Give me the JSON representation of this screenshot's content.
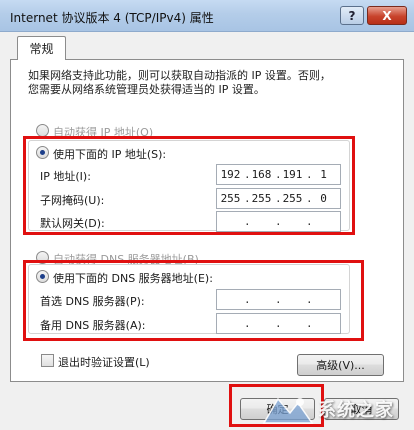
{
  "window": {
    "title": "Internet 协议版本 4 (TCP/IPv4) 属性",
    "help_label": "?",
    "close_label": "X"
  },
  "tab": {
    "label": "常规"
  },
  "description": {
    "line1": "如果网络支持此功能，则可以获取自动指派的 IP 设置。否则，",
    "line2": "您需要从网络系统管理员处获得适当的 IP 设置。"
  },
  "ip_section": {
    "auto_label": "自动获得 IP 地址(O)",
    "manual_label": "使用下面的 IP 地址(S):",
    "selected": "manual",
    "fields": [
      {
        "label": "IP 地址(I):",
        "octets": [
          "192",
          "168",
          "191",
          "1"
        ]
      },
      {
        "label": "子网掩码(U):",
        "octets": [
          "255",
          "255",
          "255",
          "0"
        ]
      },
      {
        "label": "默认网关(D):",
        "octets": [
          "",
          "",
          "",
          ""
        ]
      }
    ]
  },
  "dns_section": {
    "auto_label": "自动获得 DNS 服务器地址(B)",
    "manual_label": "使用下面的 DNS 服务器地址(E):",
    "selected": "manual",
    "fields": [
      {
        "label": "首选 DNS 服务器(P):",
        "octets": [
          "",
          "",
          "",
          ""
        ]
      },
      {
        "label": "备用 DNS 服务器(A):",
        "octets": [
          "",
          "",
          "",
          ""
        ]
      }
    ]
  },
  "validate_on_exit": {
    "label": "退出时验证设置(L)",
    "checked": false
  },
  "buttons": {
    "advanced": "高级(V)...",
    "ok": "确定",
    "cancel": "取消"
  },
  "watermark": {
    "text": "系统之家"
  },
  "colors": {
    "highlight": "#e01010",
    "titlebar": "#b4cde9",
    "panel": "#ffffff"
  }
}
